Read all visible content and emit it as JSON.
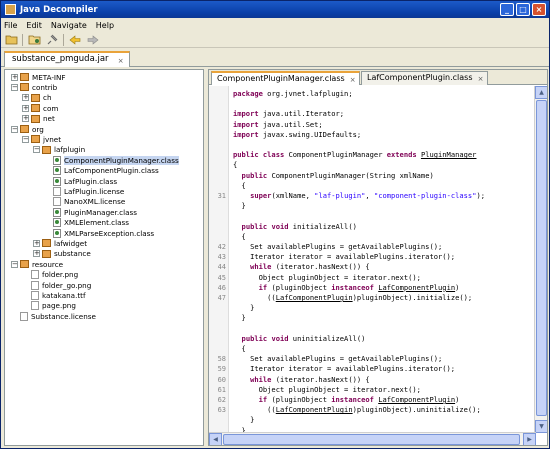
{
  "window": {
    "title": "Java Decompiler",
    "buttons": [
      "_",
      "□",
      "×"
    ]
  },
  "menu": [
    "File",
    "Edit",
    "Navigate",
    "Help"
  ],
  "toolbar": [
    "open-icon",
    "open-type-icon",
    "search-icon",
    "back-icon",
    "forward-icon"
  ],
  "file_tab": {
    "label": "substance_pmguda.jar",
    "close": "×"
  },
  "tree": [
    {
      "label": "META-INF",
      "level": 0,
      "type": "package",
      "expander": "+"
    },
    {
      "label": "contrib",
      "level": 0,
      "type": "package",
      "expander": "−"
    },
    {
      "label": "ch",
      "level": 1,
      "type": "package",
      "expander": "+"
    },
    {
      "label": "com",
      "level": 1,
      "type": "package",
      "expander": "+"
    },
    {
      "label": "net",
      "level": 1,
      "type": "package",
      "expander": "+"
    },
    {
      "label": "org",
      "level": 0,
      "type": "package",
      "expander": "−"
    },
    {
      "label": "jvnet",
      "level": 1,
      "type": "package",
      "expander": "−"
    },
    {
      "label": "lafplugin",
      "level": 2,
      "type": "package",
      "expander": "−"
    },
    {
      "label": "ComponentPluginManager.class",
      "level": 3,
      "type": "class",
      "selected": true
    },
    {
      "label": "LafComponentPlugin.class",
      "level": 3,
      "type": "class"
    },
    {
      "label": "LafPlugin.class",
      "level": 3,
      "type": "class"
    },
    {
      "label": "LafPlugin.license",
      "level": 3,
      "type": "file"
    },
    {
      "label": "NanoXML.license",
      "level": 3,
      "type": "file"
    },
    {
      "label": "PluginManager.class",
      "level": 3,
      "type": "class"
    },
    {
      "label": "XMLElement.class",
      "level": 3,
      "type": "class"
    },
    {
      "label": "XMLParseException.class",
      "level": 3,
      "type": "class"
    },
    {
      "label": "lafwidget",
      "level": 2,
      "type": "package",
      "expander": "+"
    },
    {
      "label": "substance",
      "level": 2,
      "type": "package",
      "expander": "+"
    },
    {
      "label": "resource",
      "level": 0,
      "type": "package",
      "expander": "−"
    },
    {
      "label": "folder.png",
      "level": 1,
      "type": "file"
    },
    {
      "label": "folder_go.png",
      "level": 1,
      "type": "file"
    },
    {
      "label": "katakana.ttf",
      "level": 1,
      "type": "file"
    },
    {
      "label": "page.png",
      "level": 1,
      "type": "file"
    },
    {
      "label": "Substance.license",
      "level": 0,
      "type": "file"
    }
  ],
  "code_tabs": [
    {
      "label": "ComponentPluginManager.class",
      "active": true,
      "close": "×"
    },
    {
      "label": "LafComponentPlugin.class",
      "active": false,
      "close": "×"
    }
  ],
  "code_lines": [
    {
      "n": "",
      "segs": [
        [
          "kw",
          "package"
        ],
        [
          "t",
          " org.jvnet.lafplugin;"
        ]
      ]
    },
    {
      "n": "",
      "segs": []
    },
    {
      "n": "",
      "segs": [
        [
          "kw",
          "import"
        ],
        [
          "t",
          " java.util.Iterator;"
        ]
      ]
    },
    {
      "n": "",
      "segs": [
        [
          "kw",
          "import"
        ],
        [
          "t",
          " java.util.Set;"
        ]
      ]
    },
    {
      "n": "",
      "segs": [
        [
          "kw",
          "import"
        ],
        [
          "t",
          " javax.swing.UIDefaults;"
        ]
      ]
    },
    {
      "n": "",
      "segs": []
    },
    {
      "n": "",
      "segs": [
        [
          "kw",
          "public class"
        ],
        [
          "t",
          " ComponentPluginManager "
        ],
        [
          "kw",
          "extends"
        ],
        [
          "t",
          " "
        ],
        [
          "lnk",
          "PluginManager"
        ]
      ]
    },
    {
      "n": "",
      "segs": [
        [
          "t",
          "{"
        ]
      ]
    },
    {
      "n": "",
      "segs": [
        [
          "t",
          "  "
        ],
        [
          "kw",
          "public"
        ],
        [
          "t",
          " ComponentPluginManager(String xmlName)"
        ]
      ]
    },
    {
      "n": "",
      "segs": [
        [
          "t",
          "  {"
        ]
      ]
    },
    {
      "n": "31",
      "segs": [
        [
          "t",
          "    "
        ],
        [
          "kw",
          "super"
        ],
        [
          "t",
          "(xmlName, "
        ],
        [
          "str",
          "\"laf-plugin\""
        ],
        [
          "t",
          ", "
        ],
        [
          "str",
          "\"component-plugin-class\""
        ],
        [
          "t",
          ");"
        ]
      ]
    },
    {
      "n": "",
      "segs": [
        [
          "t",
          "  }"
        ]
      ]
    },
    {
      "n": "",
      "segs": []
    },
    {
      "n": "",
      "segs": [
        [
          "t",
          "  "
        ],
        [
          "kw",
          "public void"
        ],
        [
          "t",
          " initializeAll()"
        ]
      ]
    },
    {
      "n": "",
      "segs": [
        [
          "t",
          "  {"
        ]
      ]
    },
    {
      "n": "42",
      "segs": [
        [
          "t",
          "    Set availablePlugins = getAvailablePlugins();"
        ]
      ]
    },
    {
      "n": "43",
      "segs": [
        [
          "t",
          "    Iterator iterator = availablePlugins.iterator();"
        ]
      ]
    },
    {
      "n": "44",
      "segs": [
        [
          "t",
          "    "
        ],
        [
          "kw",
          "while"
        ],
        [
          "t",
          " (iterator.hasNext()) {"
        ]
      ]
    },
    {
      "n": "45",
      "segs": [
        [
          "t",
          "      Object pluginObject = iterator.next();"
        ]
      ]
    },
    {
      "n": "46",
      "segs": [
        [
          "t",
          "      "
        ],
        [
          "kw",
          "if"
        ],
        [
          "t",
          " (pluginObject "
        ],
        [
          "kw",
          "instanceof"
        ],
        [
          "t",
          " "
        ],
        [
          "lnk",
          "LafComponentPlugin"
        ],
        [
          "t",
          ")"
        ]
      ]
    },
    {
      "n": "47",
      "segs": [
        [
          "t",
          "        (("
        ],
        [
          "lnk",
          "LafComponentPlugin"
        ],
        [
          "t",
          ")pluginObject).initialize();"
        ]
      ]
    },
    {
      "n": "",
      "segs": [
        [
          "t",
          "    }"
        ]
      ]
    },
    {
      "n": "",
      "segs": [
        [
          "t",
          "  }"
        ]
      ]
    },
    {
      "n": "",
      "segs": []
    },
    {
      "n": "",
      "segs": [
        [
          "t",
          "  "
        ],
        [
          "kw",
          "public void"
        ],
        [
          "t",
          " uninitializeAll()"
        ]
      ]
    },
    {
      "n": "",
      "segs": [
        [
          "t",
          "  {"
        ]
      ]
    },
    {
      "n": "58",
      "segs": [
        [
          "t",
          "    Set availablePlugins = getAvailablePlugins();"
        ]
      ]
    },
    {
      "n": "59",
      "segs": [
        [
          "t",
          "    Iterator iterator = availablePlugins.iterator();"
        ]
      ]
    },
    {
      "n": "60",
      "segs": [
        [
          "t",
          "    "
        ],
        [
          "kw",
          "while"
        ],
        [
          "t",
          " (iterator.hasNext()) {"
        ]
      ]
    },
    {
      "n": "61",
      "segs": [
        [
          "t",
          "      Object pluginObject = iterator.next();"
        ]
      ]
    },
    {
      "n": "62",
      "segs": [
        [
          "t",
          "      "
        ],
        [
          "kw",
          "if"
        ],
        [
          "t",
          " (pluginObject "
        ],
        [
          "kw",
          "instanceof"
        ],
        [
          "t",
          " "
        ],
        [
          "lnk",
          "LafComponentPlugin"
        ],
        [
          "t",
          ")"
        ]
      ]
    },
    {
      "n": "63",
      "segs": [
        [
          "t",
          "        (("
        ],
        [
          "lnk",
          "LafComponentPlugin"
        ],
        [
          "t",
          ")pluginObject).uninitialize();"
        ]
      ]
    },
    {
      "n": "",
      "segs": [
        [
          "t",
          "    }"
        ]
      ]
    },
    {
      "n": "",
      "segs": [
        [
          "t",
          "  }"
        ]
      ]
    }
  ]
}
